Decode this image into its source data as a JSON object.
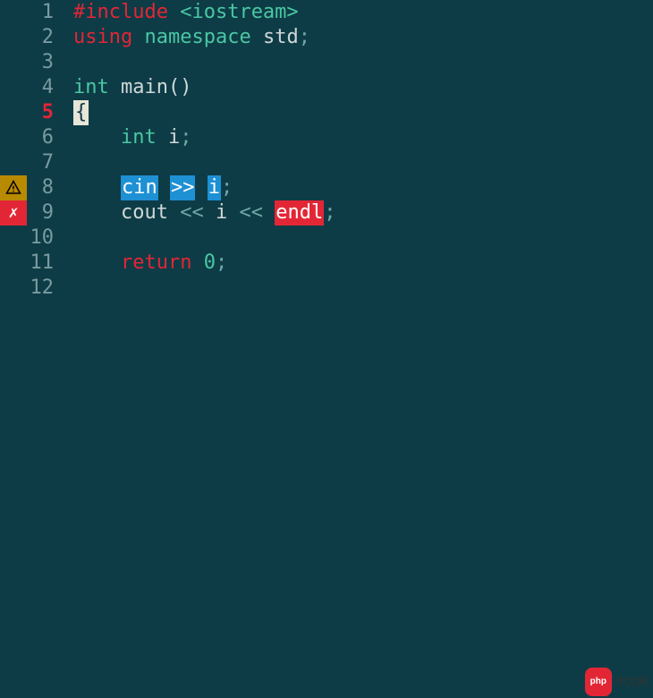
{
  "lines": [
    {
      "num": "1",
      "active": false,
      "marker": null
    },
    {
      "num": "2",
      "active": false,
      "marker": null
    },
    {
      "num": "3",
      "active": false,
      "marker": null
    },
    {
      "num": "4",
      "active": false,
      "marker": null
    },
    {
      "num": "5",
      "active": true,
      "marker": null
    },
    {
      "num": "6",
      "active": false,
      "marker": null
    },
    {
      "num": "7",
      "active": false,
      "marker": null
    },
    {
      "num": "8",
      "active": false,
      "marker": "warning"
    },
    {
      "num": "9",
      "active": false,
      "marker": "error"
    },
    {
      "num": "10",
      "active": false,
      "marker": null
    },
    {
      "num": "11",
      "active": false,
      "marker": null
    },
    {
      "num": "12",
      "active": false,
      "marker": null
    }
  ],
  "code": {
    "l1": {
      "include": "#include",
      "target": "<iostream>"
    },
    "l2": {
      "using": "using",
      "namespace": "namespace",
      "std": "std",
      "semi": ";"
    },
    "l4": {
      "int": "int",
      "main": "main",
      "parens": "()"
    },
    "l5": {
      "brace": "{"
    },
    "l6": {
      "indent": "    ",
      "int": "int",
      "i": "i",
      "semi": ";"
    },
    "l8": {
      "indent": "    ",
      "cin": "cin",
      "op": ">>",
      "i": "i",
      "semi": ";"
    },
    "l9": {
      "indent": "    ",
      "cout": "cout",
      "op1": "<<",
      "i": "i",
      "op2": "<<",
      "endl": "endl",
      "semi": ";"
    },
    "l11": {
      "indent": "    ",
      "return": "return",
      "zero": "0",
      "semi": ";"
    }
  },
  "watermark": {
    "badge": "php",
    "text": "中文网"
  },
  "error_marker_symbol": "✗"
}
